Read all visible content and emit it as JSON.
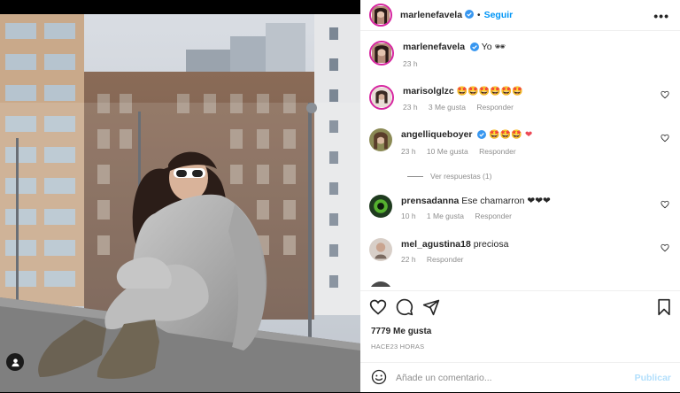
{
  "header": {
    "username": "marlenefavela",
    "follow_label": "Seguir",
    "separator": "•",
    "more_label": "•••"
  },
  "caption": {
    "username": "marlenefavela",
    "text": "Yo",
    "emoji": "🕶",
    "time": "23 h"
  },
  "comments": [
    {
      "username": "marisolglzc",
      "text": "🤩🤩🤩🤩🤩🤩",
      "time": "23 h",
      "likes": "3 Me gusta",
      "reply": "Responder",
      "verified": false
    },
    {
      "username": "angelliqueboyer",
      "text": "🤩🤩🤩 ❤",
      "time": "23 h",
      "likes": "10 Me gusta",
      "reply": "Responder",
      "verified": true
    },
    {
      "username": "prensadanna",
      "text": "Ese chamarron ❤❤❤",
      "time": "10 h",
      "likes": "1 Me gusta",
      "reply": "Responder",
      "verified": false
    },
    {
      "username": "mel_agustina18",
      "text": "preciosa",
      "time": "22 h",
      "likes": "",
      "reply": "Responder",
      "verified": false
    }
  ],
  "view_replies": "Ver respuestas (1)",
  "likes_count": "7779 Me gusta",
  "posted_ago": "HACE23 HORAS",
  "add_comment": {
    "placeholder": "Añade un comentario..."
  },
  "publish_label": "Publicar",
  "colors": {
    "accent": "#0095f6",
    "verified": "#3897f0",
    "heart": "#ed4956",
    "muted": "#8e8e8e"
  },
  "icons": [
    "tag-icon",
    "verified-icon",
    "more-icon",
    "heart-icon",
    "comment-icon",
    "share-icon",
    "bookmark-icon",
    "emoji-icon"
  ]
}
